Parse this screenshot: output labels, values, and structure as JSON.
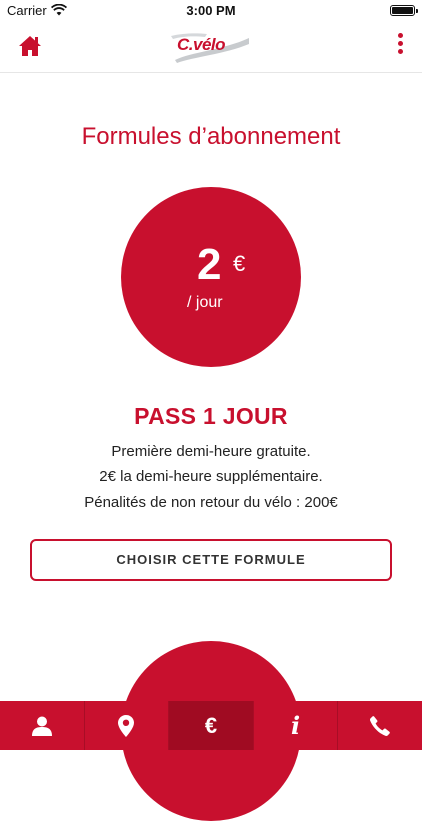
{
  "status_bar": {
    "carrier": "Carrier",
    "time": "3:00 PM"
  },
  "header": {
    "logo_text": "C.vélo"
  },
  "page": {
    "title": "Formules d’abonnement",
    "price": {
      "amount": "2",
      "currency": "€",
      "unit": "/ jour"
    },
    "pass_name": "PASS 1 JOUR",
    "description": [
      "Première demi-heure gratuite.",
      "2€ la demi-heure supplémentaire.",
      "Pénalités de non retour du vélo : 200€"
    ],
    "choose_label": "CHOISIR CETTE FORMULE"
  },
  "tabs": [
    {
      "icon": "user-icon",
      "active": false
    },
    {
      "icon": "map-pin-icon",
      "active": false
    },
    {
      "icon": "euro-icon",
      "glyph": "€",
      "active": true
    },
    {
      "icon": "info-icon",
      "glyph": "i",
      "active": false
    },
    {
      "icon": "phone-icon",
      "active": false
    }
  ],
  "colors": {
    "brand": "#c8102e",
    "active_tab": "#a00b22"
  }
}
